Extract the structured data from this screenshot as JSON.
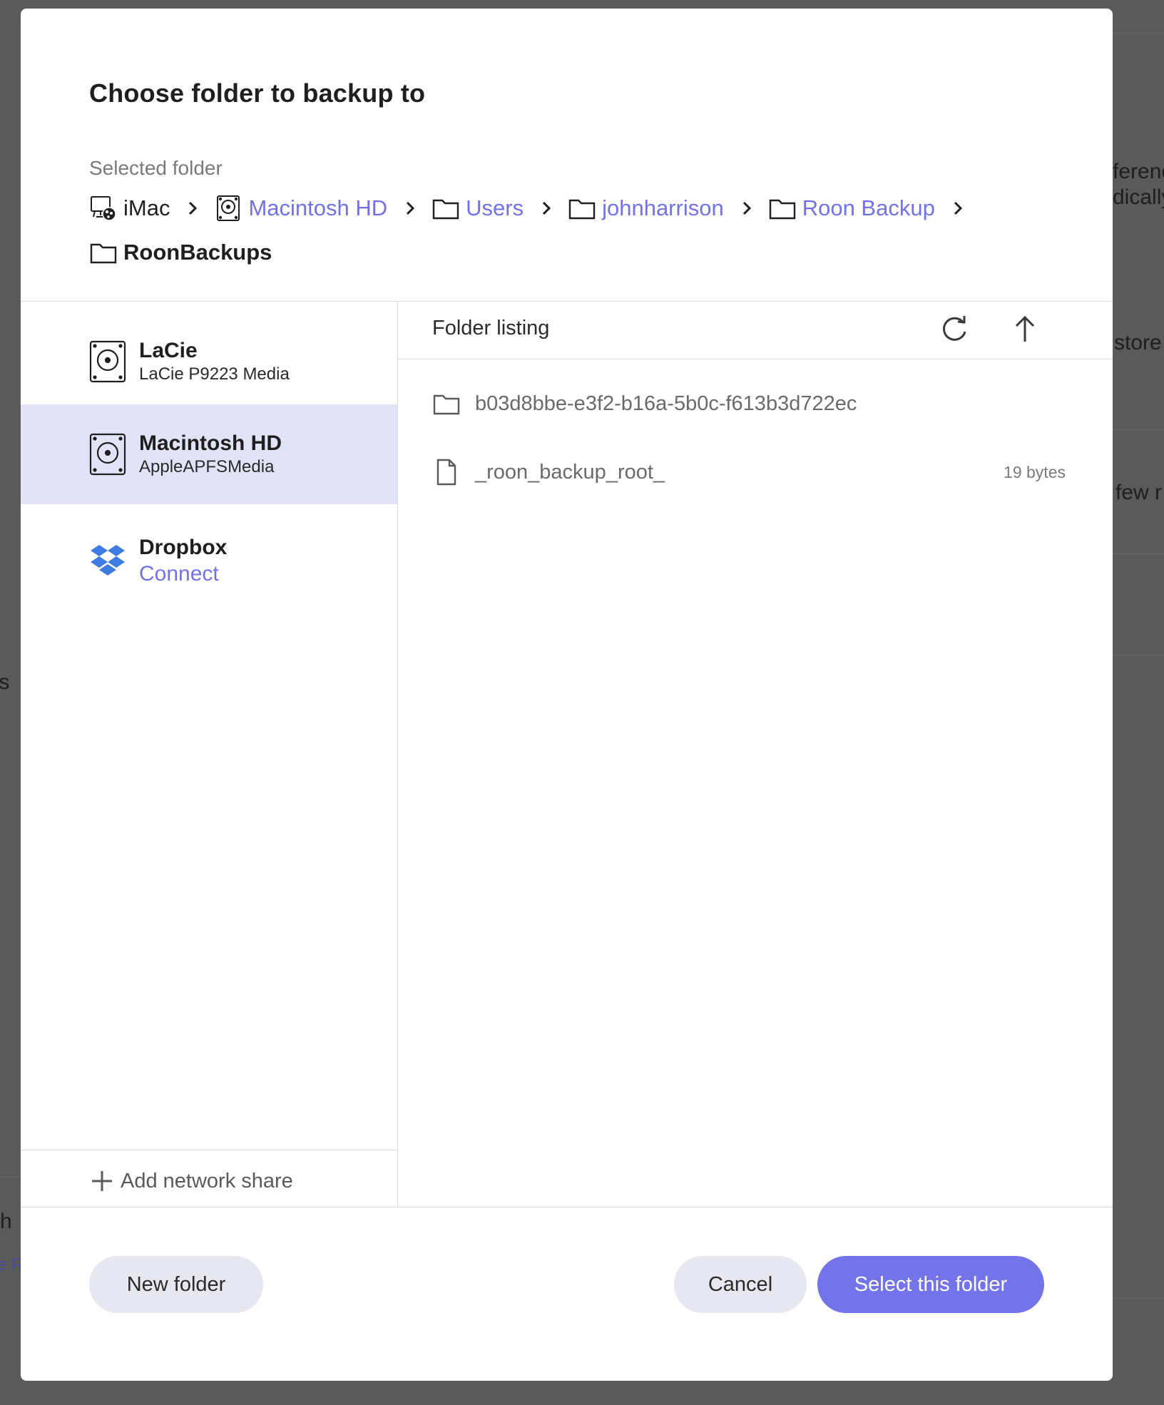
{
  "background": {
    "fragments": [
      "ferenc",
      "dically",
      "store",
      "few r",
      "ıs",
      "h",
      "e R"
    ]
  },
  "dialog": {
    "title": "Choose folder to backup to",
    "selected_label": "Selected folder",
    "breadcrumb": [
      {
        "label": "iMac",
        "icon": "computer-icon",
        "style": "plain"
      },
      {
        "label": "Macintosh HD",
        "icon": "hard-drive-icon",
        "style": "link"
      },
      {
        "label": "Users",
        "icon": "folder-icon",
        "style": "link"
      },
      {
        "label": "johnharrison",
        "icon": "folder-icon",
        "style": "link"
      },
      {
        "label": "Roon Backup",
        "icon": "folder-icon",
        "style": "link"
      },
      {
        "label": "RoonBackups",
        "icon": "folder-icon",
        "style": "bold"
      }
    ],
    "drives": [
      {
        "name": "LaCie",
        "sub": "LaCie P9223 Media",
        "icon": "hard-drive-icon",
        "selected": false
      },
      {
        "name": "Macintosh HD",
        "sub": "AppleAPFSMedia",
        "icon": "hard-drive-icon",
        "selected": true
      },
      {
        "name": "Dropbox",
        "sub": "Connect",
        "icon": "dropbox-icon",
        "selected": false
      }
    ],
    "add_network_share": "Add network share",
    "listing": {
      "title": "Folder listing",
      "items": [
        {
          "name": "b03d8bbe-e3f2-b16a-5b0c-f613b3d722ec",
          "type": "folder",
          "size": ""
        },
        {
          "name": "_roon_backup_root_",
          "type": "file",
          "size": "19 bytes"
        }
      ]
    },
    "buttons": {
      "new_folder": "New folder",
      "cancel": "Cancel",
      "select": "Select this folder"
    },
    "colors": {
      "accent": "#7474ea",
      "link": "#7272e6",
      "selected_row": "#e3e3f7",
      "dropbox": "#3d7be0"
    }
  }
}
